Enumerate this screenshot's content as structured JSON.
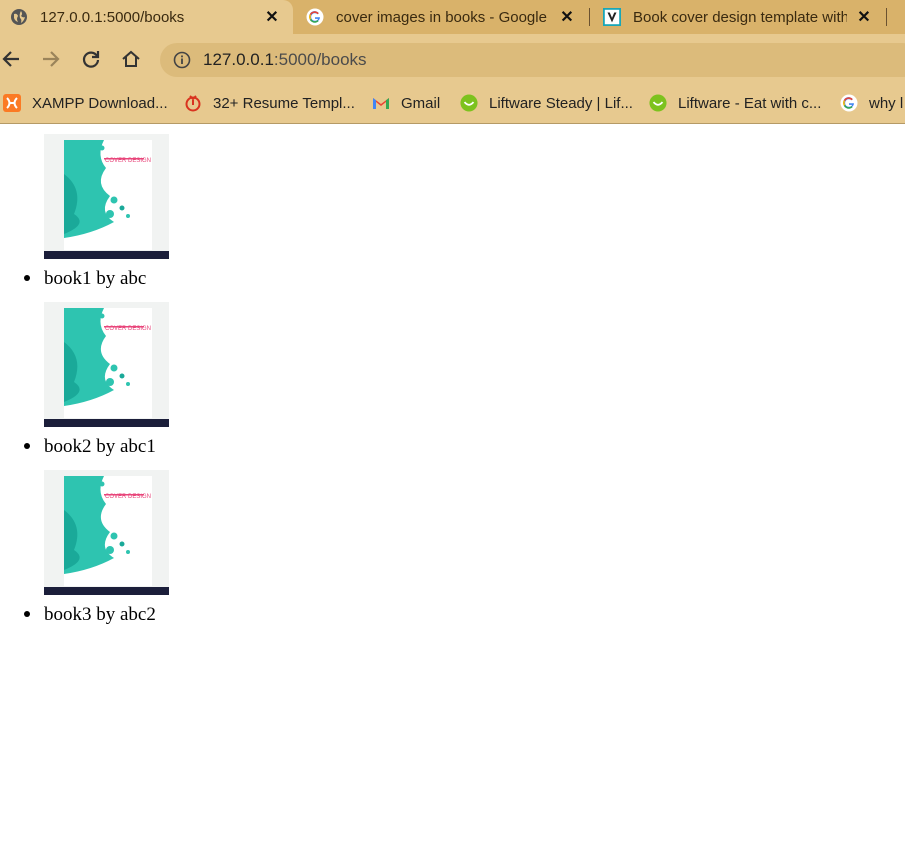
{
  "browser": {
    "tabs": [
      {
        "title": "127.0.0.1:5000/books",
        "favicon": "globe-icon",
        "active": true
      },
      {
        "title": "cover images in books - Google Search",
        "favicon": "google-icon",
        "active": false
      },
      {
        "title": "Book cover design template with",
        "favicon": "vecteezy-icon",
        "active": false
      }
    ],
    "close_glyph": "✕",
    "address": {
      "host": "127.0.0.1",
      "rest": ":5000/books"
    },
    "bookmarks": [
      {
        "label": "XAMPP Download...",
        "icon": "xampp-icon"
      },
      {
        "label": "32+ Resume Templ...",
        "icon": "resume-icon"
      },
      {
        "label": "Gmail",
        "icon": "gmail-icon"
      },
      {
        "label": "Liftware Steady | Lif...",
        "icon": "liftware-icon"
      },
      {
        "label": "Liftware - Eat with c...",
        "icon": "liftware-icon"
      },
      {
        "label": "why l",
        "icon": "google-icon"
      }
    ]
  },
  "books": [
    {
      "caption": "book1 by abc",
      "cover_text": "COVER DESIGN"
    },
    {
      "caption": "book2 by abc1",
      "cover_text": "COVER DESIGN"
    },
    {
      "caption": "book3 by abc2",
      "cover_text": "COVER DESIGN"
    }
  ],
  "colors": {
    "chrome": "#e7c98f",
    "tabstrip": "#d9b26a",
    "cover_teal": "#2ec4b0",
    "cover_pink": "#e8457a"
  }
}
